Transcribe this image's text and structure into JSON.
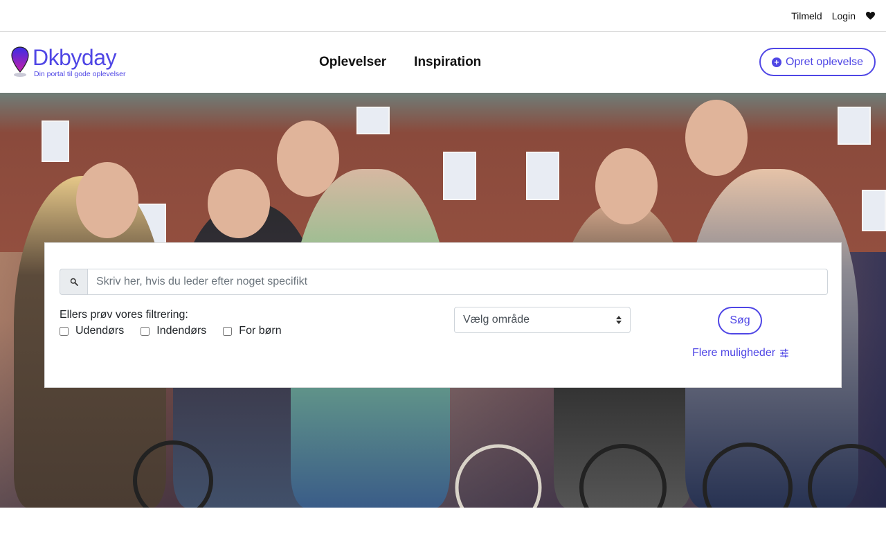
{
  "topbar": {
    "signup": "Tilmeld",
    "login": "Login"
  },
  "brand": {
    "name": "Dkbyday",
    "tagline": "Din portal til gode oplevelser",
    "color": "#4f46e5"
  },
  "nav": {
    "items": [
      "Oplevelser",
      "Inspiration"
    ]
  },
  "create_button": {
    "label": "Opret oplevelse"
  },
  "search": {
    "placeholder": "Skriv her, hvis du leder efter noget specifikt",
    "filter_label": "Ellers prøv vores filtrering:",
    "checkboxes": [
      "Udendørs",
      "Indendørs",
      "For børn"
    ],
    "area_select": "Vælg område",
    "submit": "Søg",
    "more_options": "Flere muligheder"
  }
}
